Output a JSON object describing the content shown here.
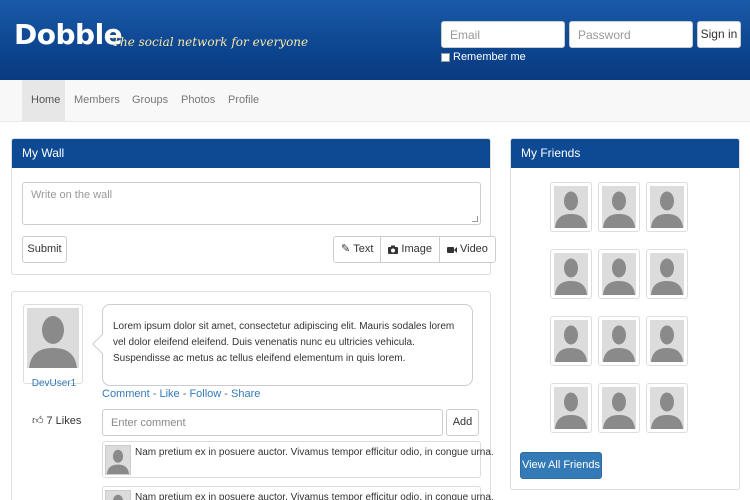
{
  "header": {
    "logo": "Dobble",
    "tagline": "The social network for everyone",
    "email_placeholder": "Email",
    "password_placeholder": "Password",
    "signin_label": "Sign in",
    "remember_label": "Remember me"
  },
  "nav": {
    "items": [
      {
        "label": "Home",
        "active": true
      },
      {
        "label": "Members"
      },
      {
        "label": "Groups"
      },
      {
        "label": "Photos"
      },
      {
        "label": "Profile"
      }
    ]
  },
  "wall": {
    "title": "My Wall",
    "textarea_placeholder": "Write on the wall",
    "submit_label": "Submit",
    "buttons": [
      {
        "label": "Text",
        "icon": "pencil-icon"
      },
      {
        "label": "Image",
        "icon": "camera-icon"
      },
      {
        "label": "Video",
        "icon": "video-camera-icon"
      }
    ]
  },
  "post": {
    "username": "DevUser1",
    "likes": "7 Likes",
    "body": "Lorem ipsum dolor sit amet, consectetur adipiscing elit. Mauris sodales lorem vel dolor eleifend eleifend. Duis venenatis nunc eu ultricies vehicula. Suspendisse ac metus ac tellus eleifend elementum in quis lorem.",
    "actions": {
      "comment": "Comment",
      "like": "Like",
      "follow": "Follow",
      "share": "Share",
      "separator": " - "
    },
    "comment_placeholder": "Enter comment",
    "add_label": "Add",
    "comments": [
      {
        "text": "Nam pretium ex in posuere auctor. Vivamus tempor efficitur odio, in congue urna."
      },
      {
        "text": "Nam pretium ex in posuere auctor. Vivamus tempor efficitur odio, in congue urna."
      }
    ]
  },
  "friends": {
    "title": "My Friends",
    "count": 12,
    "view_all_label": "View All Friends"
  },
  "colors": {
    "header_blue": "#0d4590",
    "panel_head_blue": "#0e4a94",
    "link_blue": "#337ab7",
    "tagline_yellow": "#f5e7a8"
  }
}
